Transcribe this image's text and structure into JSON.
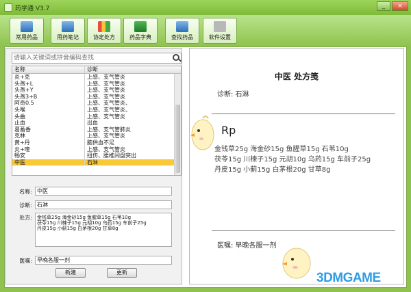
{
  "window": {
    "title": "药学通 V3.7",
    "minimize": "_",
    "close": "×"
  },
  "toolbar": [
    {
      "label": "常用药品"
    },
    {
      "label": "用药笔记"
    },
    {
      "label": "协定处方"
    },
    {
      "label": "药品字典"
    },
    {
      "label": "查找药品"
    },
    {
      "label": "软件设置"
    }
  ],
  "search": {
    "placeholder": "请输入关键词或拼音编码查找",
    "value": ""
  },
  "table": {
    "headers": [
      "名称",
      "诊断"
    ],
    "rows": [
      {
        "name": "炎+克",
        "diag": "上感、支气管炎"
      },
      {
        "name": "头孢+L",
        "diag": "上感、支气管炎"
      },
      {
        "name": "头孢+Y",
        "diag": "上感、支气管炎"
      },
      {
        "name": "头孢3+B",
        "diag": "上感、支气管炎"
      },
      {
        "name": "阿奇0.5",
        "diag": "上感、支气管炎、"
      },
      {
        "name": "头喉",
        "diag": "上感、支气管炎、"
      },
      {
        "name": "头曲",
        "diag": "上感、支气管炎"
      },
      {
        "name": "止血",
        "diag": "出血"
      },
      {
        "name": "葛蓄香",
        "diag": "上感、支气管肺炎"
      },
      {
        "name": "克林",
        "diag": "上感、支气管炎"
      },
      {
        "name": "黄+丹",
        "diag": "脑供血不足"
      },
      {
        "name": "炎+喹",
        "diag": "上感、支气管炎"
      },
      {
        "name": "畅安",
        "diag": "扭伤、腰椎间盘突出"
      },
      {
        "name": "中医",
        "diag": "石淋"
      }
    ],
    "selected_index": 13
  },
  "form": {
    "name_label": "名称:",
    "name_value": "中医",
    "diag_label": "诊断:",
    "diag_value": "石淋",
    "rx_label": "处方:",
    "rx_value": "金钱草25g   海金砂15g   鱼腥草15g   石苇10g\n茯苓15g   川楝子15g   元胡10g   乌药15g   车前子25g\n丹皮15g   小蓟15g   白茅根20g   甘草8g",
    "advice_label": "医嘱:",
    "advice_value": "早晚各服一剂",
    "new_button": "新建",
    "update_button": "更新"
  },
  "preview": {
    "title": "中医 处方笺",
    "diagnosis": "诊断: 石淋",
    "rp": "Rp",
    "lines": [
      "金钱草25g 海金砂15g 鱼腥草15g 石苇10g",
      "茯苓15g 川楝子15g 元胡10g 乌药15g 车前子25g",
      "丹皮15g 小蓟15g 白茅根20g 甘草8g"
    ],
    "advice": "医嘱: 早晚各服一剂"
  },
  "watermark": "3DMGAME",
  "colors": {
    "accent": "#8fc24e",
    "selected_row": "#f9c937",
    "watermark": "#2d9de5"
  }
}
